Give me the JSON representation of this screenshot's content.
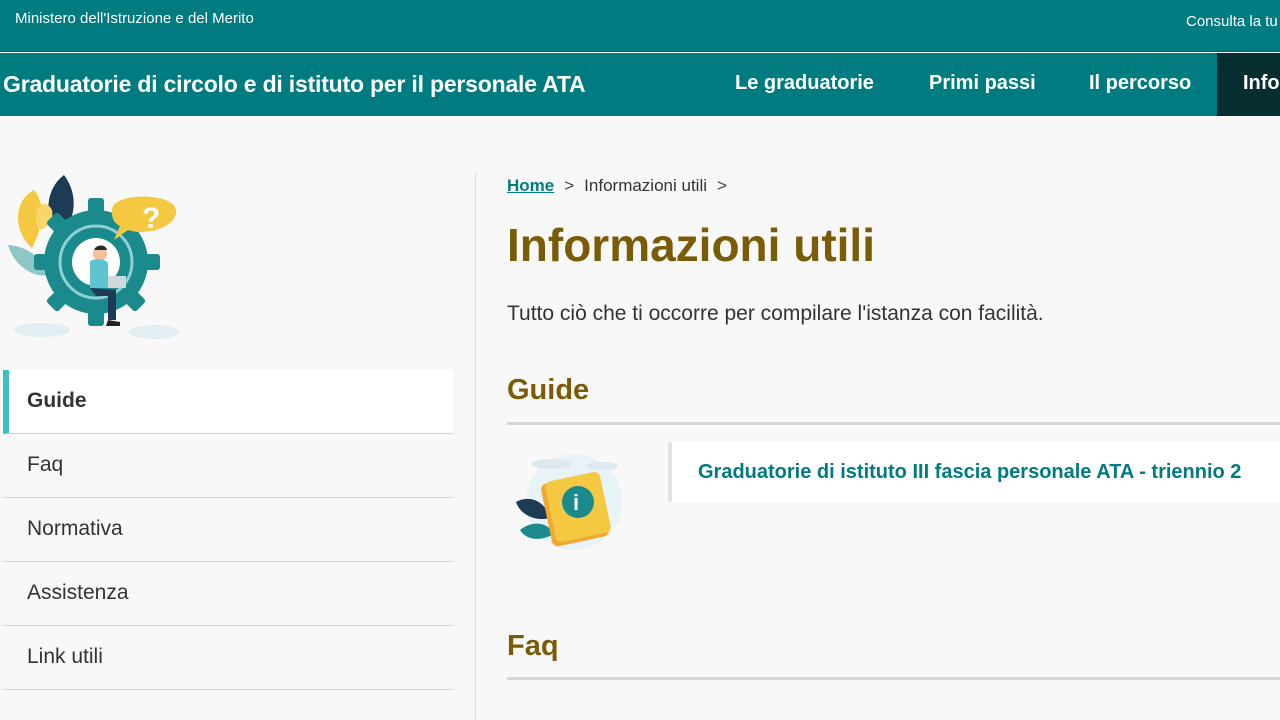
{
  "topbar": {
    "ministry": "Ministero dell'Istruzione e del Merito",
    "consult": "Consulta la tu"
  },
  "navbar": {
    "site_title": "Graduatorie di circolo e di istituto per il personale ATA",
    "items": [
      "Le graduatorie",
      "Primi passi",
      "Il percorso"
    ],
    "active_item": "Info"
  },
  "sidebar": {
    "items": [
      {
        "label": "Guide",
        "active": true
      },
      {
        "label": "Faq",
        "active": false
      },
      {
        "label": "Normativa",
        "active": false
      },
      {
        "label": "Assistenza",
        "active": false
      },
      {
        "label": "Link utili",
        "active": false
      }
    ]
  },
  "breadcrumb": {
    "home": "Home",
    "separator": ">",
    "current": "Informazioni utili"
  },
  "main": {
    "title": "Informazioni utili",
    "intro": "Tutto ciò che ti occorre per compilare l'istanza con facilità.",
    "sections": {
      "guide": {
        "title": "Guide",
        "card_link": "Graduatorie di istituto III fascia personale ATA - triennio 2"
      },
      "faq": {
        "title": "Faq"
      }
    }
  },
  "colors": {
    "brand_teal": "#007b80",
    "dark_nav": "#062e30",
    "heading_gold": "#7a5c07",
    "accent_cyan": "#3bc0c3",
    "illustration_yellow": "#f5c842"
  },
  "icons": [
    "gear-person-illustration",
    "info-book-icon"
  ]
}
